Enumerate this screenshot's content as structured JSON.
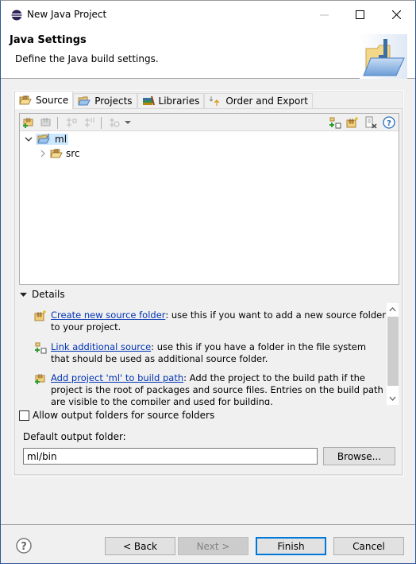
{
  "window": {
    "title": "New Java Project",
    "controls": [
      "minimize",
      "maximize",
      "close"
    ]
  },
  "header": {
    "title": "Java Settings",
    "description": "Define the Java build settings.",
    "banner_icon": "java-project-folder-icon"
  },
  "tabs": [
    {
      "label": "Source",
      "icon": "source-folder-icon",
      "active": true
    },
    {
      "label": "Projects",
      "icon": "projects-icon",
      "active": false
    },
    {
      "label": "Libraries",
      "icon": "libraries-icon",
      "active": false
    },
    {
      "label": "Order and Export",
      "icon": "order-export-icon",
      "active": false
    }
  ],
  "source_toolbar": {
    "left_tools": [
      "add-source-folder-icon",
      "remove-source-folder-icon",
      "link-source-icon",
      "unlink-source-icon",
      "configure-icon"
    ],
    "right_tools": [
      "link-additional-source-icon",
      "new-source-folder-icon",
      "remove-icon",
      "help-icon"
    ]
  },
  "tree": {
    "items": [
      {
        "label": "ml",
        "expanded": true,
        "selected": true,
        "level": 0,
        "icon": "java-project-icon"
      },
      {
        "label": "src",
        "expanded": false,
        "selected": false,
        "level": 1,
        "icon": "source-folder-icon"
      }
    ]
  },
  "details": {
    "label": "Details",
    "expanded": true,
    "items": [
      {
        "link": "Create new source folder",
        "text": ": use this if you want to add a new source folder to your project."
      },
      {
        "link": "Link additional source",
        "text": ": use this if you have a folder in the file system that should be used as additional source folder."
      },
      {
        "link": "Add project 'ml' to build path",
        "text": ": Add the project to the build path if the project is the root of packages and source files. Entries on the build path are visible to the compiler and used for building."
      }
    ]
  },
  "options": {
    "allow_output_folders_label": "Allow output folders for source folders",
    "allow_output_folders_checked": false,
    "default_output_label": "Default output folder:",
    "default_output_value": "ml/bin",
    "browse_label": "Browse..."
  },
  "buttons": {
    "back": "< Back",
    "next": "Next >",
    "finish": "Finish",
    "cancel": "Cancel"
  },
  "colors": {
    "link": "#0033b3",
    "selection": "#cce8ff",
    "default_button_border": "#0078d7"
  }
}
